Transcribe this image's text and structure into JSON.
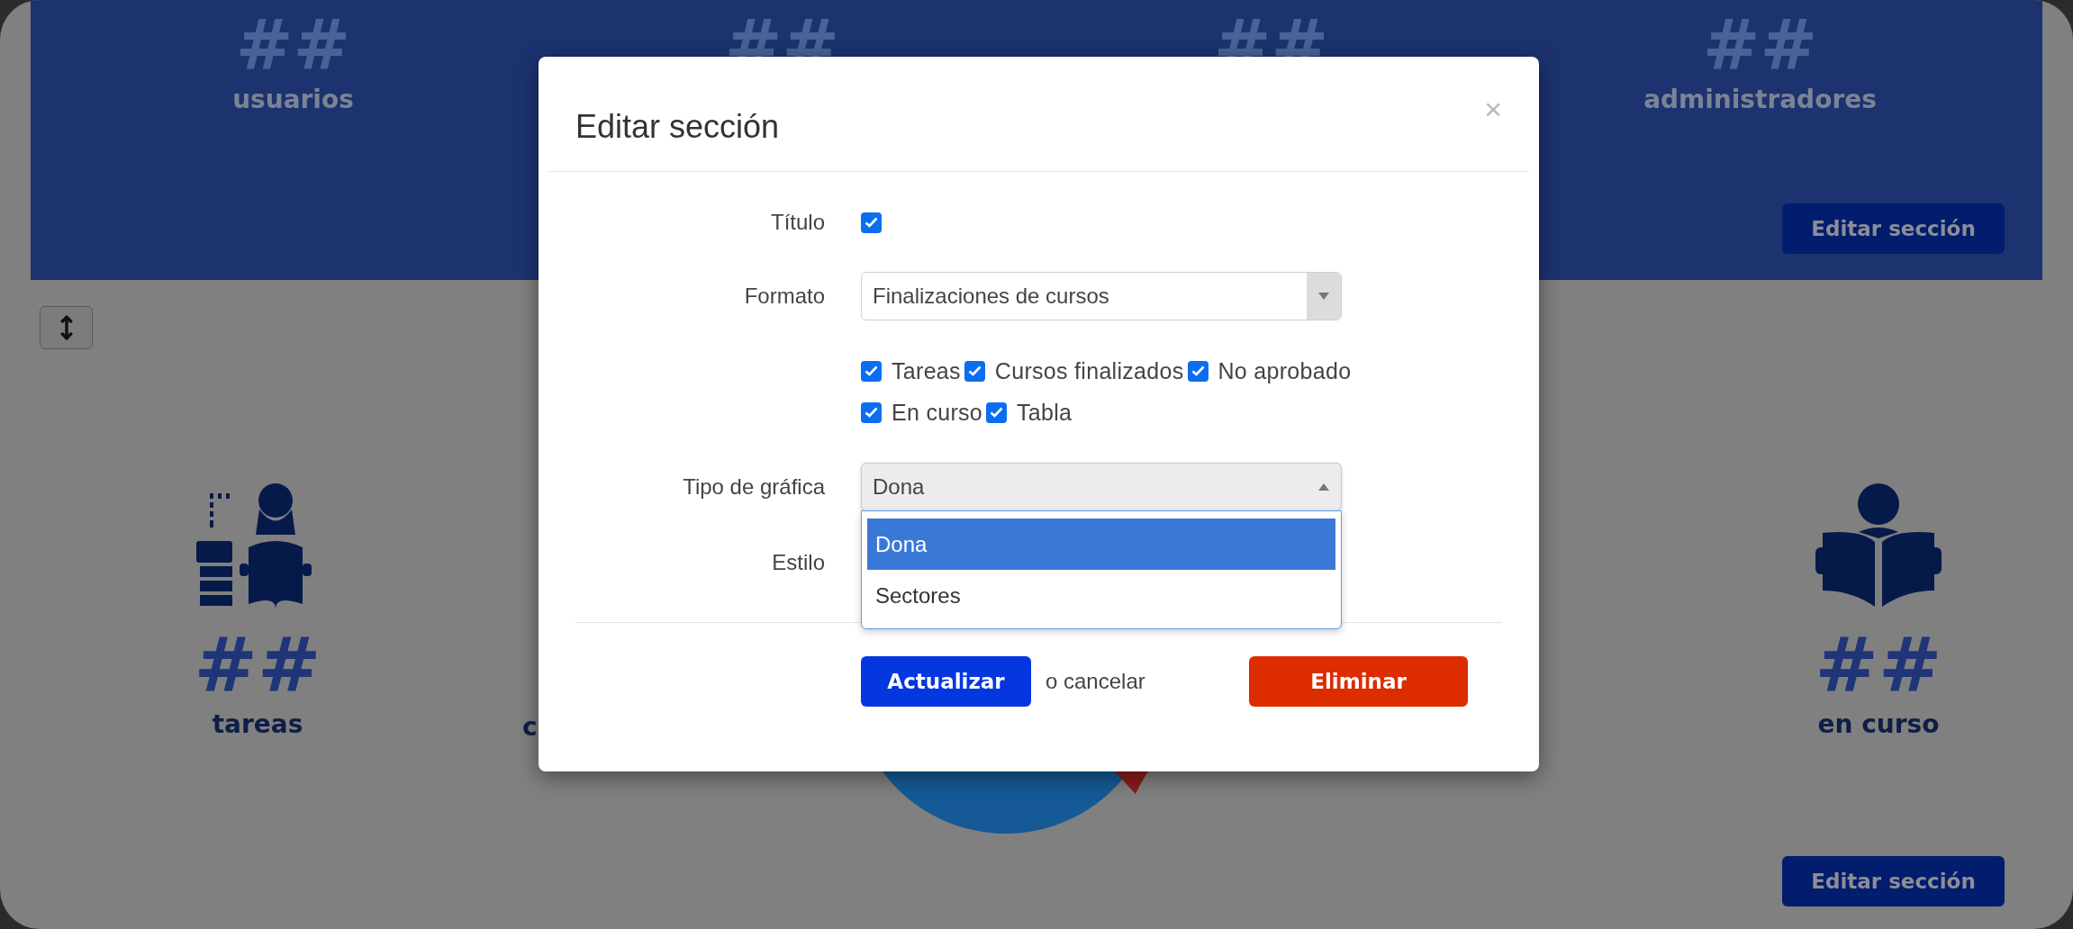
{
  "top_section": {
    "stats": [
      {
        "value": "##",
        "label": "usuarios"
      },
      {
        "value": "##"
      },
      {
        "value": "##"
      },
      {
        "value": "##",
        "label": "administradores"
      }
    ],
    "edit_button": "Editar sección"
  },
  "bottom_section": {
    "stats": [
      {
        "kind": "tasks",
        "value": "##",
        "label": "tareas"
      },
      {
        "kind": "label",
        "label": "c"
      },
      {
        "kind": "reading",
        "value": "##",
        "label": "en curso"
      }
    ],
    "edit_button": "Editar sección"
  },
  "modal": {
    "title": "Editar sección",
    "close": "×",
    "fields": [
      {
        "kind": "checkbox",
        "label": "Título",
        "checked": true
      },
      {
        "kind": "select",
        "label": "Formato",
        "value": "Finalizaciones de cursos",
        "expanded": false
      },
      {
        "kind": "checks",
        "rows": [
          {
            "options": [
              {
                "label": "Tareas",
                "checked": true
              },
              {
                "label": "Cursos finalizados",
                "checked": true
              },
              {
                "label": "No aprobado",
                "checked": true
              }
            ]
          },
          {
            "options": [
              {
                "label": "En curso",
                "checked": true
              },
              {
                "label": "Tabla",
                "checked": true
              }
            ]
          }
        ]
      },
      {
        "kind": "select",
        "label": "Tipo de gráfica",
        "value": "Dona",
        "expanded": true,
        "options": [
          {
            "label": "Dona",
            "selected": true
          },
          {
            "label": "Sectores",
            "selected": false
          }
        ]
      },
      {
        "kind": "label",
        "label": "Estilo"
      }
    ],
    "footer": {
      "submit": "Actualizar",
      "cancel": "o cancelar",
      "delete": "Eliminar"
    }
  }
}
